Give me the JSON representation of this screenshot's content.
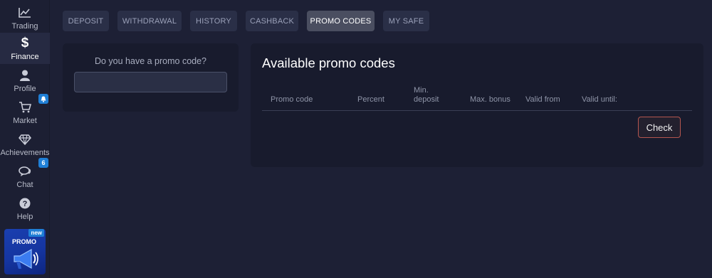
{
  "sidebar": {
    "items": [
      {
        "label": "Trading",
        "icon": "chart-line-icon"
      },
      {
        "label": "Finance",
        "icon": "dollar-icon"
      },
      {
        "label": "Profile",
        "icon": "user-icon"
      },
      {
        "label": "Market",
        "icon": "cart-icon",
        "badge": "bell"
      },
      {
        "label": "Achievements",
        "icon": "diamond-icon"
      },
      {
        "label": "Chat",
        "icon": "chat-icon",
        "badge": "6"
      },
      {
        "label": "Help",
        "icon": "help-icon"
      }
    ],
    "active": "Finance",
    "promo": {
      "label": "PROMO",
      "badge": "new",
      "icon": "megaphone-icon"
    }
  },
  "tabs": [
    {
      "label": "DEPOSIT"
    },
    {
      "label": "WITHDRAWAL"
    },
    {
      "label": "HISTORY"
    },
    {
      "label": "CASHBACK"
    },
    {
      "label": "PROMO CODES"
    },
    {
      "label": "MY SAFE"
    }
  ],
  "active_tab": "PROMO CODES",
  "promo_entry": {
    "question": "Do you have a promo code?",
    "value": "",
    "placeholder": ""
  },
  "available": {
    "title": "Available promo codes",
    "columns": {
      "code": "Promo code",
      "percent": "Percent",
      "min_deposit": "Min. deposit",
      "max_bonus": "Max. bonus",
      "valid_from": "Valid from",
      "valid_until": "Valid until:"
    },
    "rows": [],
    "check_label": "Check"
  },
  "colors": {
    "background": "#1d2035",
    "panel": "#181b2d",
    "tab": "#2a2f47",
    "tab_active": "#4a4e60",
    "badge": "#1f7fd6",
    "check_border": "#b4564f"
  }
}
